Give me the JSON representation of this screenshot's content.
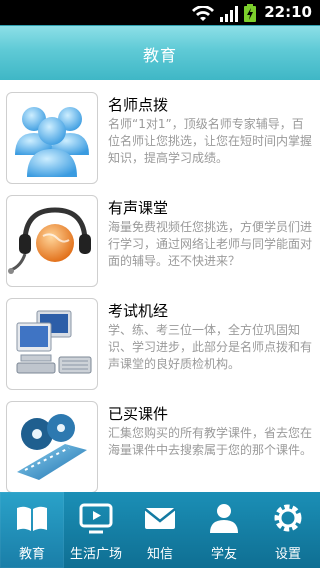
{
  "status": {
    "time": "22:10"
  },
  "header": {
    "title": "教育"
  },
  "items": [
    {
      "title": "名师点拨",
      "desc": "名师“1对1”，顶级名师专家辅导，百位名师让您挑选，让您在短时间内掌握知识，提高学习成绩。",
      "icon": "users-icon"
    },
    {
      "title": "有声课堂",
      "desc": "海量免费视频任您挑选，方便学员们进行学习，通过网络让老师与同学能面对面的辅导。还不快进来？",
      "icon": "headset-globe-icon"
    },
    {
      "title": "考试机经",
      "desc": "学、练、考三位一体，全方位巩固知识、学习进步，此部分是名师点拨和有声课堂的良好质检机构。",
      "icon": "computer-icon"
    },
    {
      "title": "已买课件",
      "desc": "汇集您购买的所有教学课件，省去您在海量课件中去搜索属于您的那个课件。",
      "icon": "film-reel-icon"
    }
  ],
  "tabs": [
    {
      "label": "教育",
      "icon": "book-icon",
      "active": true
    },
    {
      "label": "生活广场",
      "icon": "tv-icon",
      "active": false
    },
    {
      "label": "知信",
      "icon": "envelope-icon",
      "active": false
    },
    {
      "label": "学友",
      "icon": "person-icon",
      "active": false
    },
    {
      "label": "设置",
      "icon": "gear-icon",
      "active": false
    }
  ],
  "colors": {
    "header": "#5fcad6",
    "tabbar": "#0f6f93",
    "text_gray": "#9a9a9a"
  }
}
